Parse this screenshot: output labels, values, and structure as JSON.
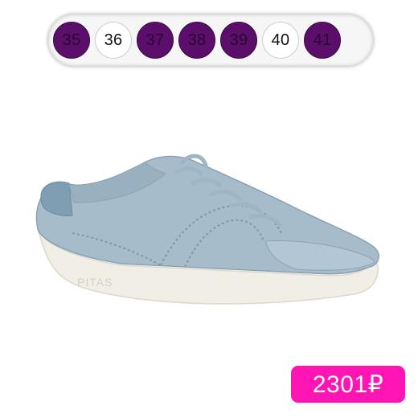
{
  "size_selector": {
    "sizes": [
      {
        "label": "35",
        "available": true
      },
      {
        "label": "36",
        "available": false
      },
      {
        "label": "37",
        "available": true
      },
      {
        "label": "38",
        "available": true
      },
      {
        "label": "39",
        "available": true
      },
      {
        "label": "40",
        "available": false
      },
      {
        "label": "41",
        "available": true
      }
    ]
  },
  "product": {
    "image_icon": "sneaker-image",
    "logo_text": "PITAS",
    "price": "2301₽"
  },
  "colors": {
    "chip_available": "#5b0f6a",
    "chip_unavailable": "#ffffff",
    "price_badge": "#ff14b4",
    "shoe_upper": "#a6bccb",
    "shoe_sole": "#f1eee6"
  }
}
